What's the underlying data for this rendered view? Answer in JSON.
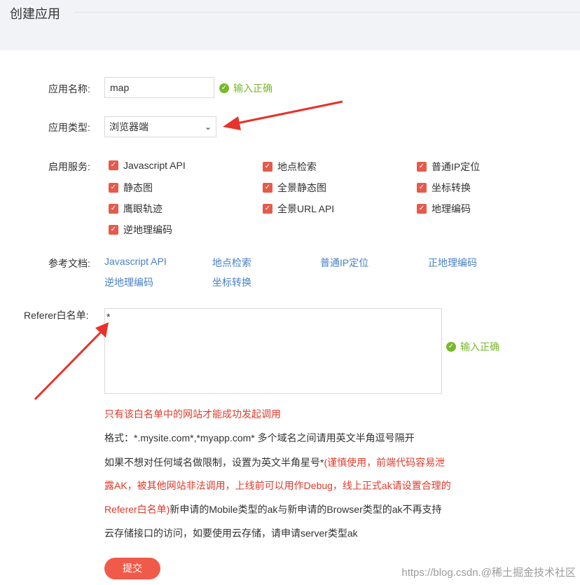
{
  "page": {
    "title": "创建应用"
  },
  "app_name": {
    "label": "应用名称:",
    "value": "map",
    "status": "输入正确"
  },
  "app_type": {
    "label": "应用类型:",
    "selected": "浏览器端"
  },
  "services": {
    "label": "启用服务:",
    "items": [
      {
        "label": "Javascript API",
        "checked": true
      },
      {
        "label": "地点检索",
        "checked": true
      },
      {
        "label": "普通IP定位",
        "checked": true
      },
      {
        "label": "静态图",
        "checked": true
      },
      {
        "label": "全景静态图",
        "checked": true
      },
      {
        "label": "坐标转换",
        "checked": true
      },
      {
        "label": "鹰眼轨迹",
        "checked": true
      },
      {
        "label": "全景URL API",
        "checked": true
      },
      {
        "label": "地理编码",
        "checked": true
      },
      {
        "label": "逆地理编码",
        "checked": true
      }
    ]
  },
  "docs": {
    "label": "参考文档:",
    "links": [
      "Javascript API",
      "地点检索",
      "普通IP定位",
      "正地理编码",
      "逆地理编码",
      "坐标转换"
    ]
  },
  "referer": {
    "label": "Referer白名单:",
    "value": "*",
    "status": "输入正确"
  },
  "notes": {
    "line1": "只有该白名单中的网站才能成功发起调用",
    "line2": "格式：*.mysite.com*,*myapp.com* 多个域名之间请用英文半角逗号隔开",
    "line3_dark": "如果不想对任何域名做限制，设置为英文半角星号*",
    "line3_red": "(谨慎使用，前端代码容易泄",
    "line4": "露AK，被其他网站非法调用，上线前可以用作Debug，线上正式ak请设置合理的",
    "line5_red": "Referer白名单)",
    "line5_dark": "新申请的Mobile类型的ak与新申请的Browser类型的ak不再支持",
    "line6": "云存储接口的访问，如要使用云存储，请申请server类型ak"
  },
  "submit_label": "提交",
  "watermark": "https://blog.csdn.@稀土掘金技术社区",
  "colors": {
    "accent": "#e65a4c",
    "ok": "#7ab82b",
    "link": "#4a80c5",
    "arrow": "#e8322a"
  }
}
